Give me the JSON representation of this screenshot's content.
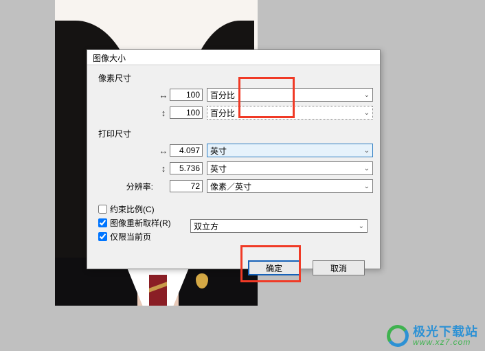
{
  "dialog": {
    "title": "图像大小",
    "pixel_section": "像素尺寸",
    "print_section": "打印尺寸",
    "width_value": "100",
    "height_value": "100",
    "pixel_unit": "百分比",
    "print_width": "4.097",
    "print_height": "5.736",
    "print_unit": "英寸",
    "resolution_label": "分辨率:",
    "resolution_value": "72",
    "resolution_unit": "像素／英寸",
    "constrain_label": "约束比例(C)",
    "resample_label": "图像重新取样(R)",
    "current_only_label": "仅限当前页",
    "resample_method": "双立方",
    "ok_label": "确定",
    "cancel_label": "取消"
  },
  "watermark": {
    "cn": "极光下载站",
    "url": "www.xz7.com"
  }
}
